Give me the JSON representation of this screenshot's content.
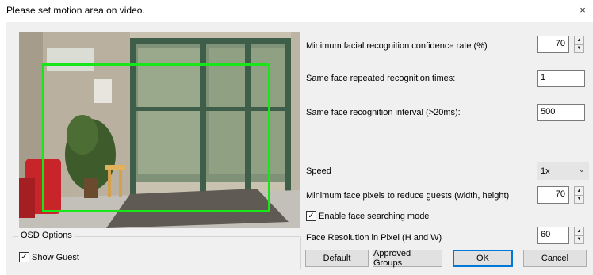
{
  "window": {
    "title": "Please set motion area on video.",
    "close_glyph": "×"
  },
  "osd": {
    "legend": "OSD Options",
    "show_guest_label": "Show Guest",
    "show_guest_checked": true
  },
  "settings": {
    "min_conf_label": "Minimum facial recognition confidence rate (%)",
    "min_conf_value": "70",
    "repeat_label": "Same face repeated recognition times:",
    "repeat_value": "1",
    "interval_label": "Same face recognition interval (>20ms):",
    "interval_value": "500",
    "speed_label": "Speed",
    "speed_value": "1x",
    "min_pixels_label": "Minimum face pixels to reduce guests (width, height)",
    "min_pixels_value": "70",
    "face_search_label": "Enable face searching mode",
    "face_search_checked": true,
    "resolution_label": "Face Resolution in Pixel (H and W)",
    "resolution_value": "60"
  },
  "buttons": {
    "default": "Default",
    "approved_groups": "Approved Groups",
    "ok": "OK",
    "cancel": "Cancel"
  },
  "icons": {
    "close": "close-icon",
    "spin_up": "spin-up-icon",
    "spin_down": "spin-down-icon",
    "dropdown": "chevron-down-icon",
    "check": "checkmark-icon"
  },
  "colors": {
    "motion_area": "#19e619",
    "ok_border": "#0078d7"
  }
}
